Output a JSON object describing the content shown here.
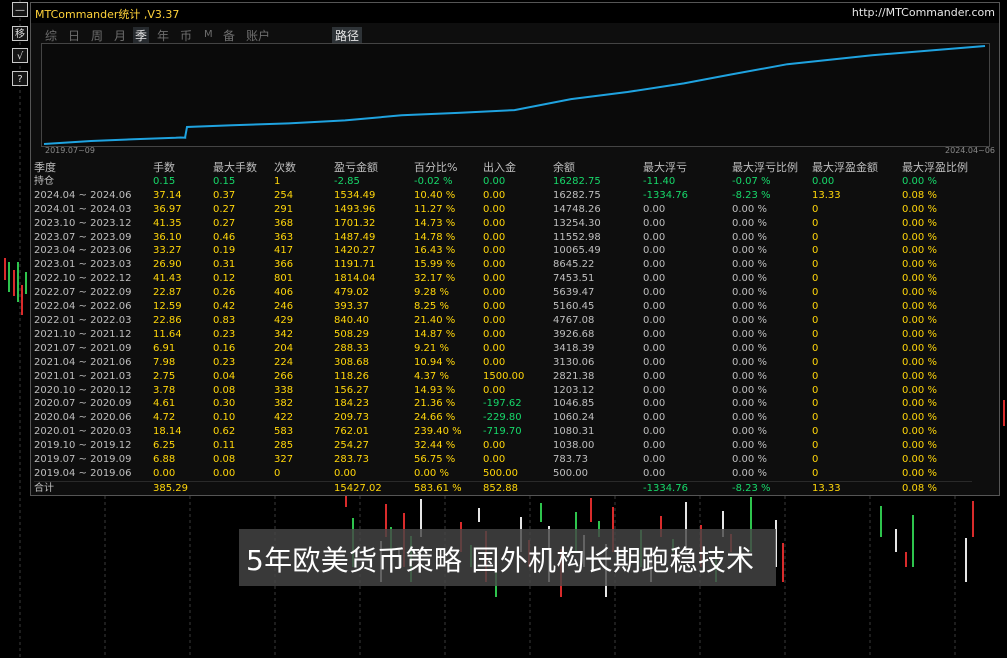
{
  "app": {
    "title": "MTCommander统计 ,V3.37",
    "url": "http://MTCommander.com"
  },
  "side_buttons": [
    "—",
    "移",
    "√",
    "?"
  ],
  "tabs": [
    "综",
    "日",
    "周",
    "月",
    "季",
    "年",
    "币",
    "M",
    "备",
    "账户"
  ],
  "active_tab": "季",
  "path_tab": "路径",
  "curve": {
    "start_label": "2019.07~09",
    "end_label": "2024.04~06",
    "line_color": "#1fa3e0",
    "points": [
      0,
      500,
      783.73,
      1038.0,
      1080.31,
      1060.24,
      1046.85,
      1203.12,
      2821.38,
      3130.06,
      3418.39,
      3926.68,
      4767.08,
      5160.45,
      5639.47,
      7453.51,
      8645.22,
      10065.49,
      11552.98,
      13254.3,
      14748.26,
      16282.75
    ]
  },
  "colors": {
    "yellow": "#ffd60a",
    "green": "#17d86a",
    "grey": "#bfbfbf",
    "title": "#ffd23a",
    "banner_bg": "#464646"
  },
  "table": {
    "headers": [
      "季度",
      "手数",
      "最大手数",
      "次数",
      "盈亏金额",
      "百分比%",
      "出入金",
      "余额",
      "最大浮亏",
      "最大浮亏比例",
      "最大浮盈金额",
      "最大浮盈比例"
    ],
    "holding": [
      "持仓",
      "0.15",
      "0.15",
      "1",
      "-2.85",
      "-0.02 %",
      "0.00",
      "16282.75",
      "-11.40",
      "-0.07 %",
      "0.00",
      "0.00 %"
    ],
    "rows": [
      [
        "2024.04 ~ 2024.06",
        "37.14",
        "0.37",
        "254",
        "1534.49",
        "10.40 %",
        "0.00",
        "16282.75",
        "-1334.76",
        "-8.23 %",
        "13.33",
        "0.08 %"
      ],
      [
        "2024.01 ~ 2024.03",
        "36.97",
        "0.27",
        "291",
        "1493.96",
        "11.27 %",
        "0.00",
        "14748.26",
        "0.00",
        "0.00 %",
        "0",
        "0.00 %"
      ],
      [
        "2023.10 ~ 2023.12",
        "41.35",
        "0.27",
        "368",
        "1701.32",
        "14.73 %",
        "0.00",
        "13254.30",
        "0.00",
        "0.00 %",
        "0",
        "0.00 %"
      ],
      [
        "2023.07 ~ 2023.09",
        "36.10",
        "0.46",
        "363",
        "1487.49",
        "14.78 %",
        "0.00",
        "11552.98",
        "0.00",
        "0.00 %",
        "0",
        "0.00 %"
      ],
      [
        "2023.04 ~ 2023.06",
        "33.27",
        "0.19",
        "417",
        "1420.27",
        "16.43 %",
        "0.00",
        "10065.49",
        "0.00",
        "0.00 %",
        "0",
        "0.00 %"
      ],
      [
        "2023.01 ~ 2023.03",
        "26.90",
        "0.31",
        "366",
        "1191.71",
        "15.99 %",
        "0.00",
        "8645.22",
        "0.00",
        "0.00 %",
        "0",
        "0.00 %"
      ],
      [
        "2022.10 ~ 2022.12",
        "41.43",
        "0.12",
        "801",
        "1814.04",
        "32.17 %",
        "0.00",
        "7453.51",
        "0.00",
        "0.00 %",
        "0",
        "0.00 %"
      ],
      [
        "2022.07 ~ 2022.09",
        "22.87",
        "0.26",
        "406",
        "479.02",
        "9.28 %",
        "0.00",
        "5639.47",
        "0.00",
        "0.00 %",
        "0",
        "0.00 %"
      ],
      [
        "2022.04 ~ 2022.06",
        "12.59",
        "0.42",
        "246",
        "393.37",
        "8.25 %",
        "0.00",
        "5160.45",
        "0.00",
        "0.00 %",
        "0",
        "0.00 %"
      ],
      [
        "2022.01 ~ 2022.03",
        "22.86",
        "0.83",
        "429",
        "840.40",
        "21.40 %",
        "0.00",
        "4767.08",
        "0.00",
        "0.00 %",
        "0",
        "0.00 %"
      ],
      [
        "2021.10 ~ 2021.12",
        "11.64",
        "0.23",
        "342",
        "508.29",
        "14.87 %",
        "0.00",
        "3926.68",
        "0.00",
        "0.00 %",
        "0",
        "0.00 %"
      ],
      [
        "2021.07 ~ 2021.09",
        "6.91",
        "0.16",
        "204",
        "288.33",
        "9.21 %",
        "0.00",
        "3418.39",
        "0.00",
        "0.00 %",
        "0",
        "0.00 %"
      ],
      [
        "2021.04 ~ 2021.06",
        "7.98",
        "0.23",
        "224",
        "308.68",
        "10.94 %",
        "0.00",
        "3130.06",
        "0.00",
        "0.00 %",
        "0",
        "0.00 %"
      ],
      [
        "2021.01 ~ 2021.03",
        "2.75",
        "0.04",
        "266",
        "118.26",
        "4.37 %",
        "1500.00",
        "2821.38",
        "0.00",
        "0.00 %",
        "0",
        "0.00 %"
      ],
      [
        "2020.10 ~ 2020.12",
        "3.78",
        "0.08",
        "338",
        "156.27",
        "14.93 %",
        "0.00",
        "1203.12",
        "0.00",
        "0.00 %",
        "0",
        "0.00 %"
      ],
      [
        "2020.07 ~ 2020.09",
        "4.61",
        "0.30",
        "382",
        "184.23",
        "21.36 %",
        "-197.62",
        "1046.85",
        "0.00",
        "0.00 %",
        "0",
        "0.00 %"
      ],
      [
        "2020.04 ~ 2020.06",
        "4.72",
        "0.10",
        "422",
        "209.73",
        "24.66 %",
        "-229.80",
        "1060.24",
        "0.00",
        "0.00 %",
        "0",
        "0.00 %"
      ],
      [
        "2020.01 ~ 2020.03",
        "18.14",
        "0.62",
        "583",
        "762.01",
        "239.40 %",
        "-719.70",
        "1080.31",
        "0.00",
        "0.00 %",
        "0",
        "0.00 %"
      ],
      [
        "2019.10 ~ 2019.12",
        "6.25",
        "0.11",
        "285",
        "254.27",
        "32.44 %",
        "0.00",
        "1038.00",
        "0.00",
        "0.00 %",
        "0",
        "0.00 %"
      ],
      [
        "2019.07 ~ 2019.09",
        "6.88",
        "0.08",
        "327",
        "283.73",
        "56.75 %",
        "0.00",
        "783.73",
        "0.00",
        "0.00 %",
        "0",
        "0.00 %"
      ],
      [
        "2019.04 ~ 2019.06",
        "0.00",
        "0.00",
        "0",
        "0.00",
        "0.00 %",
        "500.00",
        "500.00",
        "0.00",
        "0.00 %",
        "0",
        "0.00 %"
      ]
    ],
    "total": [
      "合计",
      "385.29",
      "",
      "",
      "15427.02",
      "583.61 %",
      "852.88",
      "",
      "-1334.76",
      "-8.23 %",
      "13.33",
      "0.08 %"
    ]
  },
  "banner": {
    "text": "5年欧美货币策略 国外机构长期跑稳技术"
  }
}
